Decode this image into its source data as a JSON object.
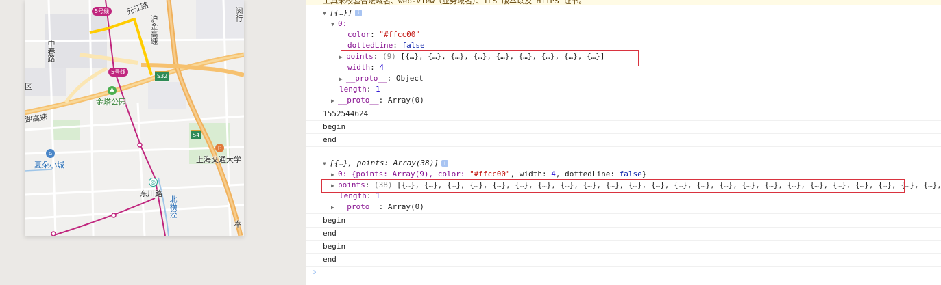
{
  "map": {
    "labels": {
      "metro_line_5_top": "5号线",
      "metro_line_5_mid": "5号线",
      "yuanjiang_road": "元江路",
      "hugao_expressway": "沪金高速",
      "zhongchun_road": "中春路",
      "district": "区",
      "minhang": "闵行",
      "shield_s32": "S32",
      "shield_s4": "S4",
      "jinta_park": "金塔公园",
      "huhu_expressway": "湖高速",
      "xiaduo_town": "夏朵小城",
      "sjtu": "上海交通大学",
      "dongchuan_road": "东川路",
      "beiheng_jing": "北横泾",
      "feng_corner": "奉"
    }
  },
  "console": {
    "warning_text": "工具未校验合法域名、web-view（业务域名）、TLS 版本以及 HTTPS 证书。",
    "group1": {
      "summary": "[{…}]",
      "info": "i",
      "index0": "0:",
      "color_key": "color",
      "color_val": "\"#ffcc00\"",
      "dotted_key": "dottedLine",
      "dotted_val": "false",
      "points_key": "points",
      "points_count": "(9)",
      "points_preview": "[{…}, {…}, {…}, {…}, {…}, {…}, {…}, {…}, {…}]",
      "width_key": "width",
      "width_val": "4",
      "proto_key": "__proto__",
      "proto_val": "Object",
      "length_key": "length",
      "length_val": "1",
      "proto2_key": "__proto__",
      "proto2_val": "Array(0)"
    },
    "log_timestamp": "1552544624",
    "log_begin_1": "begin",
    "log_end_1": "end",
    "group2": {
      "summary": "[{…}, points: Array(38)]",
      "info": "i",
      "entry0": "0: {points: Array(9), color: ",
      "entry0_color": "\"#ffcc00\"",
      "entry0_width_key": ", width: ",
      "entry0_width": "4",
      "entry0_dotted_key": ", dottedLine: ",
      "entry0_dotted": "false",
      "entry0_close": "}",
      "points_key": "points",
      "points_count": "(38)",
      "points_preview": "[{…}, {…}, {…}, {…}, {…}, {…}, {…}, {…}, {…}, {…}, {…}, {…}, {…}, {…}, {…}, {…}, {…}, {…}, {…}, {…}, {…}, {…}, {…}, {…},",
      "length_key": "length",
      "length_val": "1",
      "proto_key": "__proto__",
      "proto_val": "Array(0)"
    },
    "log_begin_2": "begin",
    "log_end_2": "end",
    "log_begin_3": "begin",
    "log_end_3": "end",
    "prompt": "›"
  },
  "colors": {
    "polyline": "#ffcc00",
    "metro": "#c0267e",
    "highlight_box": "#d9333f"
  }
}
